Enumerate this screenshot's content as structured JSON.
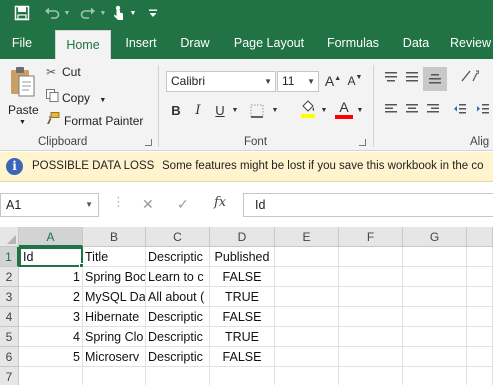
{
  "qat": {
    "icons": [
      "save-icon",
      "undo-icon",
      "redo-icon",
      "touch-mode-icon",
      "customize-qat-icon"
    ]
  },
  "tabs": [
    "File",
    "Home",
    "Insert",
    "Draw",
    "Page Layout",
    "Formulas",
    "Data",
    "Review"
  ],
  "active_tab": "Home",
  "ribbon": {
    "clipboard": {
      "paste_label": "Paste",
      "cut_label": "Cut",
      "copy_label": "Copy",
      "format_painter_label": "Format Painter",
      "group_label": "Clipboard"
    },
    "font": {
      "font_name": "Calibri",
      "font_size": "11",
      "bold": "B",
      "italic": "I",
      "underline": "U",
      "grow": "A",
      "shrink": "A",
      "font_color_letter": "A",
      "group_label": "Font",
      "highlight_color": "#ffff00",
      "font_color": "#ff0000"
    },
    "alignment": {
      "group_label": "Alig"
    }
  },
  "message_bar": {
    "title": "POSSIBLE DATA LOSS",
    "text": "Some features might be lost if you save this workbook in the co"
  },
  "formula_bar": {
    "name_box": "A1",
    "cancel_symbol": "✕",
    "enter_symbol": "✓",
    "fx_symbol": "fx",
    "formula": "Id"
  },
  "sheet": {
    "columns": [
      "A",
      "B",
      "C",
      "D",
      "E",
      "F",
      "G"
    ],
    "rows": [
      "1",
      "2",
      "3",
      "4",
      "5",
      "6",
      "7"
    ],
    "cells": [
      [
        "Id",
        "Title",
        "Descriptic",
        "Published",
        "",
        "",
        ""
      ],
      [
        "1",
        "Spring Boo",
        "Learn to c",
        "FALSE",
        "",
        "",
        ""
      ],
      [
        "2",
        "MySQL Da",
        "All about (",
        "TRUE",
        "",
        "",
        ""
      ],
      [
        "3",
        "Hibernate",
        "Descriptic",
        "FALSE",
        "",
        "",
        ""
      ],
      [
        "4",
        "Spring Clo",
        "Descriptic",
        "TRUE",
        "",
        "",
        ""
      ],
      [
        "5",
        "Microserv",
        "Descriptic",
        "FALSE",
        "",
        "",
        ""
      ],
      [
        "",
        "",
        "",
        "",
        "",
        "",
        ""
      ]
    ],
    "active_cell": "A1"
  },
  "colors": {
    "excel_green": "#217346",
    "message_bar_bg": "#fff4ce",
    "info_icon": "#3b66b8"
  }
}
